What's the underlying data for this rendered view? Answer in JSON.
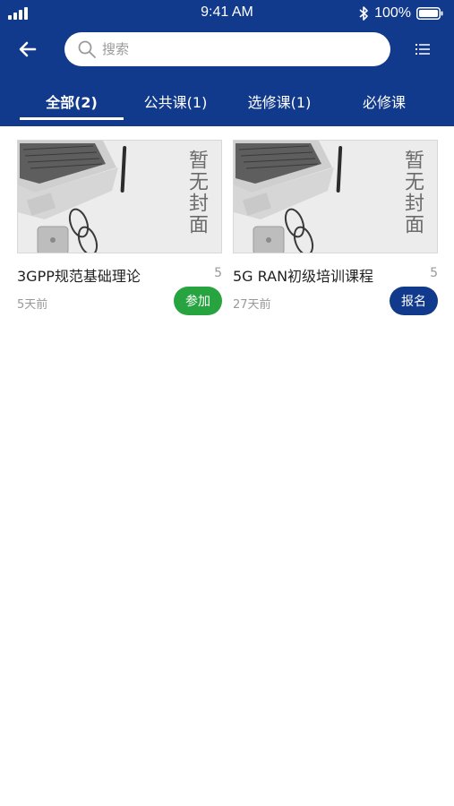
{
  "status_bar": {
    "time": "9:41 AM",
    "battery": "100%"
  },
  "search": {
    "placeholder": "搜索"
  },
  "tabs": [
    {
      "label": "全部(2)",
      "active": true
    },
    {
      "label": "公共课(1)",
      "active": false
    },
    {
      "label": "选修课(1)",
      "active": false
    },
    {
      "label": "必修课",
      "active": false
    }
  ],
  "courses": [
    {
      "cover_text": "暂无封面",
      "title": "3GPP规范基础理论",
      "count": "5",
      "date": "5天前",
      "action_label": "参加",
      "action_color": "#27a33f"
    },
    {
      "cover_text": "暂无封面",
      "title": "5G RAN初级培训课程",
      "count": "5",
      "date": "27天前",
      "action_label": "报名",
      "action_color": "#123a8c"
    }
  ],
  "colors": {
    "header": "#123a8c",
    "join_button": "#27a33f",
    "enroll_button": "#123a8c"
  }
}
